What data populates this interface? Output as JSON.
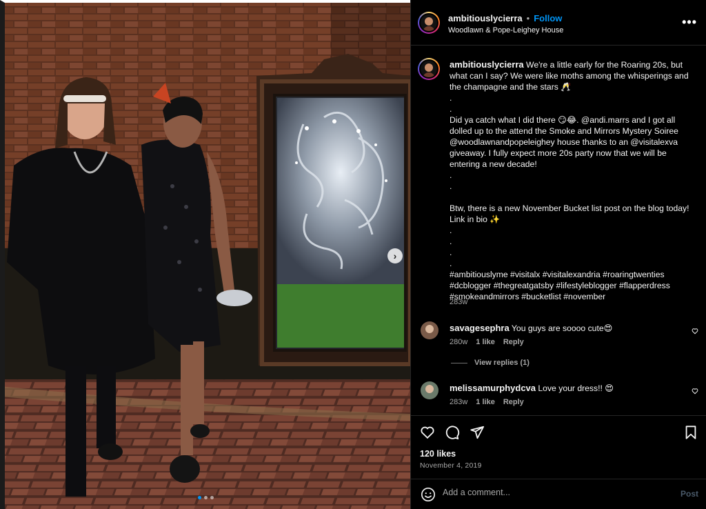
{
  "post": {
    "username": "ambitiouslycierra",
    "follow_label": "Follow",
    "separator": "•",
    "location": "Woodlawn & Pope-Leighey House",
    "more_icon": "more-icon"
  },
  "caption": {
    "username": "ambitiouslycierra",
    "lines": [
      "We're a little early for the Roaring 20s, but",
      "what can I say? We were like moths among the whisperings and",
      "the champagne and the stars 🥂",
      ".",
      ".",
      "Did ya catch what I did there 😏😂. @andi.marrs and I got all",
      "dolled up to the attend the Smoke and Mirrors Mystery Soiree",
      "@woodlawnandpopeleighey house thanks to an @visitalexva",
      "giveaway. I fully expect more 20s party now that we will be",
      "entering a new decade!",
      ".",
      ".",
      "",
      "Btw, there is a new November Bucket list post on the blog today!",
      "Link in bio ✨",
      ".",
      ".",
      ".",
      ".",
      "#ambitiouslyme #visitalx #visitalexandria #roaringtwenties",
      "#dcblogger #thegreatgatsby #lifestyleblogger #flapperdress",
      "#smokeandmirrors #bucketlist #november"
    ],
    "time": "283w"
  },
  "comments": [
    {
      "username": "savagesephra",
      "text": "You guys are soooo cute😍",
      "time": "280w",
      "likes": "1 like",
      "reply": "Reply"
    },
    {
      "username": "melissamurphydcva",
      "text": "Love your dress!! 😍",
      "time": "283w",
      "likes": "1 like",
      "reply": "Reply"
    }
  ],
  "view_replies": "View replies (1)",
  "actions": {
    "likes": "120 likes",
    "date": "November 4, 2019"
  },
  "comment_bar": {
    "placeholder": "Add a comment...",
    "post_label": "Post"
  },
  "carousel": {
    "next_glyph": "›"
  },
  "colors": {
    "accent": "#0095f6",
    "background": "#000000",
    "muted": "#a8a8a8"
  }
}
